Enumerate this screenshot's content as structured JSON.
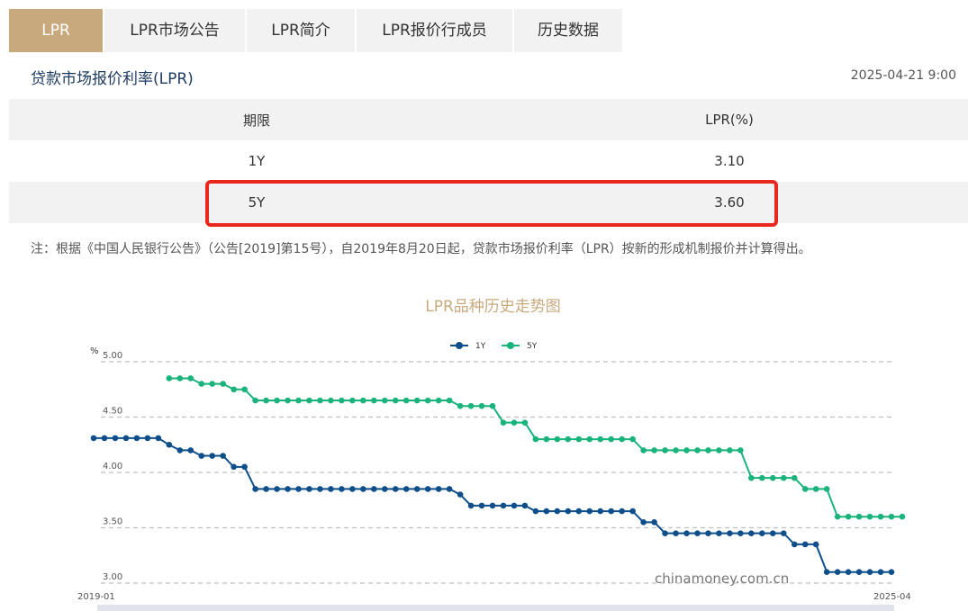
{
  "tabs": [
    {
      "label": "LPR",
      "active": true
    },
    {
      "label": "LPR市场公告"
    },
    {
      "label": "LPR简介"
    },
    {
      "label": "LPR报价行成员"
    },
    {
      "label": "历史数据"
    }
  ],
  "subtitle": "贷款市场报价利率(LPR)",
  "timestamp": "2025-04-21 9:00",
  "table": {
    "headers": [
      "期限",
      "LPR(%)"
    ],
    "rows": [
      {
        "term": "1Y",
        "rate": "3.10"
      },
      {
        "term": "5Y",
        "rate": "3.60"
      }
    ]
  },
  "note": "注：根据《中国人民银行公告》（公告[2019]第15号），自2019年8月20日起，贷款市场报价利率（LPR）按新的形成机制报价并计算得出。",
  "watermark": "chinamoney.com.cn",
  "colors": {
    "accent": "#c8a97e",
    "series_1y": "#0e4f8b",
    "series_5y": "#19b37b",
    "highlight": "#e8281e"
  },
  "chart_data": {
    "type": "line",
    "title": "LPR品种历史走势图",
    "ylabel": "%",
    "ylim": [
      3.0,
      5.0
    ],
    "yticks": [
      "5.00",
      "4.50",
      "4.00",
      "3.50",
      "3.00"
    ],
    "x_start_label": "2019-01",
    "x_end_label": "2025-04",
    "legend_position": "top-center",
    "grid": true,
    "series": [
      {
        "name": "1Y",
        "color": "#0e4f8b",
        "values": [
          4.31,
          4.31,
          4.31,
          4.31,
          4.31,
          4.31,
          4.31,
          4.25,
          4.2,
          4.2,
          4.15,
          4.15,
          4.15,
          4.05,
          4.05,
          3.85,
          3.85,
          3.85,
          3.85,
          3.85,
          3.85,
          3.85,
          3.85,
          3.85,
          3.85,
          3.85,
          3.85,
          3.85,
          3.85,
          3.85,
          3.85,
          3.85,
          3.85,
          3.85,
          3.8,
          3.7,
          3.7,
          3.7,
          3.7,
          3.7,
          3.7,
          3.65,
          3.65,
          3.65,
          3.65,
          3.65,
          3.65,
          3.65,
          3.65,
          3.65,
          3.65,
          3.55,
          3.55,
          3.45,
          3.45,
          3.45,
          3.45,
          3.45,
          3.45,
          3.45,
          3.45,
          3.45,
          3.45,
          3.45,
          3.45,
          3.35,
          3.35,
          3.35,
          3.1,
          3.1,
          3.1,
          3.1,
          3.1,
          3.1,
          3.1
        ]
      },
      {
        "name": "5Y",
        "color": "#19b37b",
        "values": [
          null,
          null,
          null,
          null,
          null,
          null,
          null,
          4.85,
          4.85,
          4.85,
          4.8,
          4.8,
          4.8,
          4.75,
          4.75,
          4.65,
          4.65,
          4.65,
          4.65,
          4.65,
          4.65,
          4.65,
          4.65,
          4.65,
          4.65,
          4.65,
          4.65,
          4.65,
          4.65,
          4.65,
          4.65,
          4.65,
          4.65,
          4.65,
          4.6,
          4.6,
          4.6,
          4.6,
          4.45,
          4.45,
          4.45,
          4.3,
          4.3,
          4.3,
          4.3,
          4.3,
          4.3,
          4.3,
          4.3,
          4.3,
          4.3,
          4.2,
          4.2,
          4.2,
          4.2,
          4.2,
          4.2,
          4.2,
          4.2,
          4.2,
          4.2,
          3.95,
          3.95,
          3.95,
          3.95,
          3.95,
          3.85,
          3.85,
          3.85,
          3.6,
          3.6,
          3.6,
          3.6,
          3.6,
          3.6,
          3.6
        ]
      }
    ]
  }
}
